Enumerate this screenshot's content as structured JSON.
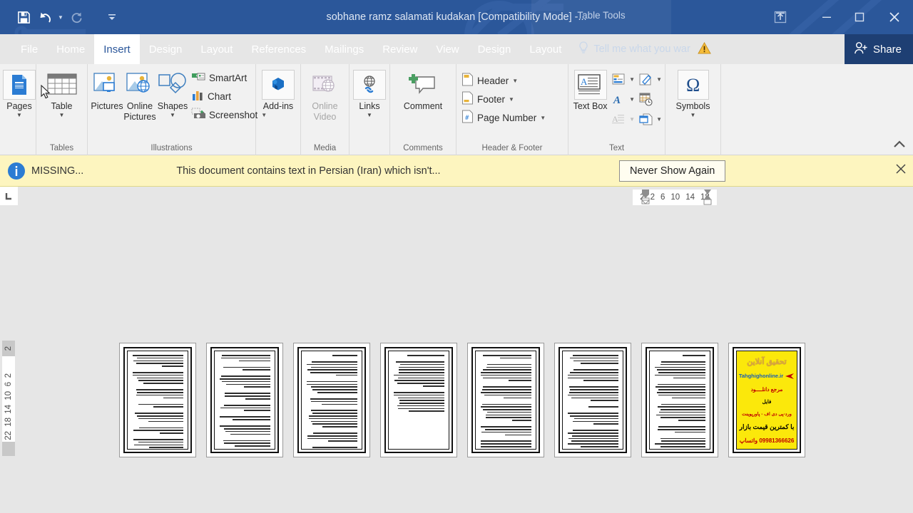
{
  "window": {
    "title": "sobhane ramz salamati kudakan [Compatibility Mode] -...",
    "contextual_tab_group": "Table Tools",
    "quick_access": [
      {
        "name": "save",
        "icon": "save-icon",
        "enabled": true
      },
      {
        "name": "undo",
        "icon": "undo-icon",
        "enabled": true
      },
      {
        "name": "redo",
        "icon": "redo-icon",
        "enabled": false
      },
      {
        "name": "customize-quick-access-toolbar",
        "icon": "chevron-down-icon",
        "enabled": true
      }
    ],
    "controls": {
      "ribbon_display_options": "ribbon-display-options-icon",
      "minimize": "minimize-icon",
      "restore": "restore-icon",
      "close": "close-icon"
    },
    "accent_color": "#2b579a",
    "share_background": "#1e3f73"
  },
  "tabs": {
    "main": [
      "File",
      "Home",
      "Insert",
      "Design",
      "Layout",
      "References",
      "Mailings",
      "Review",
      "View"
    ],
    "contextual": [
      "Design",
      "Layout"
    ],
    "active": "Insert"
  },
  "tellme": {
    "placeholder": "Tell me what you war",
    "icon": "lightbulb-icon",
    "warning_icon": "warning-triangle-icon"
  },
  "share": {
    "label": "Share",
    "icon": "person-add-icon"
  },
  "ribbon": {
    "collapse_icon": "chevron-up-icon",
    "groups": [
      {
        "name": "pages",
        "label": "",
        "items": [
          {
            "label": "Pages",
            "icon": "pages-icon",
            "dropdown": true,
            "framed": true
          }
        ]
      },
      {
        "name": "tables",
        "label": "Tables",
        "items": [
          {
            "label": "Table",
            "icon": "table-icon",
            "dropdown": true,
            "framed": false
          }
        ]
      },
      {
        "name": "illustrations",
        "label": "Illustrations",
        "items": [
          {
            "label": "Pictures",
            "icon": "pictures-icon",
            "dropdown": false
          },
          {
            "label": "Online Pictures",
            "icon": "online-pictures-icon",
            "dropdown": false
          },
          {
            "label": "Shapes",
            "icon": "shapes-icon",
            "dropdown": true
          }
        ],
        "small_items": [
          {
            "label": "SmartArt",
            "icon": "smartart-icon",
            "dropdown": false
          },
          {
            "label": "Chart",
            "icon": "chart-icon",
            "dropdown": false
          },
          {
            "label": "Screenshot",
            "icon": "screenshot-icon",
            "dropdown": true
          }
        ]
      },
      {
        "name": "add-ins",
        "label": "",
        "items": [
          {
            "label": "Add-ins",
            "icon": "addins-icon",
            "dropdown": true,
            "framed": true
          }
        ]
      },
      {
        "name": "media",
        "label": "Media",
        "items": [
          {
            "label": "Online Video",
            "icon": "online-video-icon",
            "disabled": true
          }
        ]
      },
      {
        "name": "links-group",
        "label": "",
        "items": [
          {
            "label": "Links",
            "icon": "links-icon",
            "dropdown": true,
            "framed": true
          }
        ]
      },
      {
        "name": "comments",
        "label": "Comments",
        "items": [
          {
            "label": "Comment",
            "icon": "comment-icon",
            "dropdown": false
          }
        ]
      },
      {
        "name": "header-footer",
        "label": "Header & Footer",
        "small_items": [
          {
            "label": "Header",
            "icon": "header-icon",
            "dropdown": true
          },
          {
            "label": "Footer",
            "icon": "footer-icon",
            "dropdown": true
          },
          {
            "label": "Page Number",
            "icon": "page-number-icon",
            "dropdown": true
          }
        ]
      },
      {
        "name": "text",
        "label": "Text",
        "items": [
          {
            "label": "Text Box",
            "icon": "text-box-icon",
            "dropdown": true,
            "framed": true
          }
        ],
        "mini_items": [
          {
            "icon": "quick-parts-icon",
            "dropdown": true
          },
          {
            "icon": "signature-line-icon",
            "dropdown": true
          },
          {
            "icon": "wordart-icon",
            "dropdown": true
          },
          {
            "icon": "date-time-icon",
            "dropdown": false
          },
          {
            "icon": "drop-cap-icon",
            "dropdown": true,
            "disabled": true
          },
          {
            "icon": "object-icon",
            "dropdown": true
          }
        ]
      },
      {
        "name": "symbols",
        "label": "",
        "items": [
          {
            "label": "Symbols",
            "icon": "omega-icon",
            "dropdown": true,
            "framed": true
          }
        ]
      }
    ]
  },
  "notification": {
    "icon": "info-icon",
    "title": "MISSING...",
    "message": "This document contains text in Persian (Iran) which isn't...",
    "button": "Never Show Again",
    "close_icon": "close-icon",
    "background": "#fdf5bf"
  },
  "ruler": {
    "tab_stop_selector": "left-tab-stop-icon",
    "horizontal_ticks": [
      "2",
      "2",
      "6",
      "10",
      "14",
      "18"
    ],
    "vertical_ticks": [
      "2",
      "2",
      "6",
      "10",
      "14",
      "18",
      "22"
    ],
    "left_indent_marker": "indent-marker-icon",
    "right_indent_marker": "indent-marker-icon"
  },
  "document": {
    "view": "multiple-pages",
    "page_count": 8,
    "pages": [
      {
        "n": 1,
        "type": "text",
        "lines": [
          5,
          5,
          4,
          2,
          4,
          3,
          4,
          3,
          4,
          3,
          5,
          3
        ]
      },
      {
        "n": 2,
        "type": "text",
        "lines": [
          3,
          2,
          5,
          3,
          3,
          2,
          4,
          3,
          7,
          6,
          2
        ]
      },
      {
        "n": 3,
        "type": "text",
        "lines": [
          1,
          6,
          5,
          3,
          7,
          4,
          2,
          3
        ]
      },
      {
        "n": 4,
        "type": "text",
        "lines": [
          1,
          10,
          8
        ]
      },
      {
        "n": 5,
        "type": "text",
        "lines": [
          2,
          7,
          5,
          7,
          4,
          6
        ]
      },
      {
        "n": 6,
        "type": "text",
        "lines": [
          4,
          5,
          6,
          1,
          5,
          7
        ]
      },
      {
        "n": 7,
        "type": "text",
        "lines": [
          1,
          7,
          6,
          7,
          3,
          5
        ]
      },
      {
        "n": 8,
        "type": "ad",
        "content": {
          "headline": "تحقیق آنلاین",
          "site": "Tahghighonline.ir",
          "line1": "مرجع دانلــــود",
          "line2": "فایل",
          "line3": "ورد-پی دی اف - پاورپوینت",
          "line4": "با کمترین قیمت بازار",
          "line5": "09981366626 واتساپ",
          "background": "#fbe80b"
        }
      }
    ]
  }
}
